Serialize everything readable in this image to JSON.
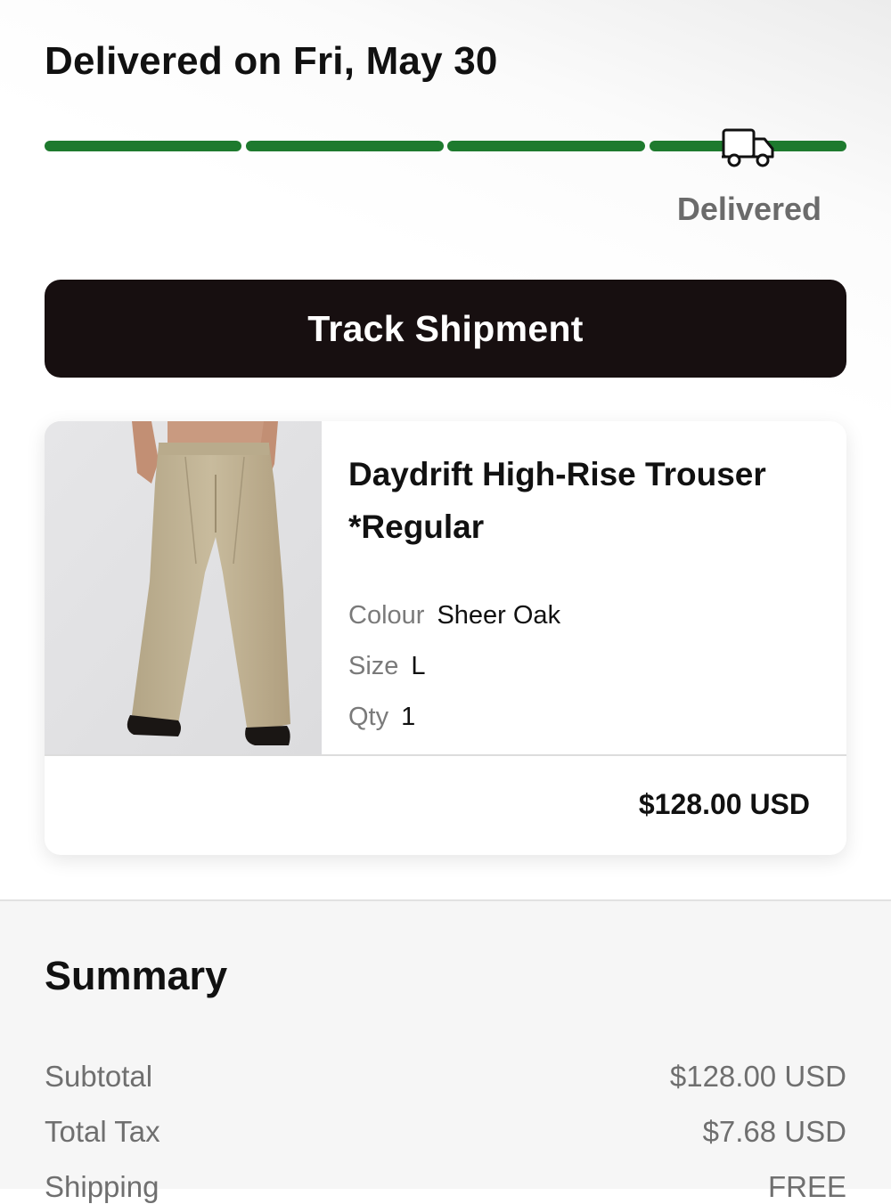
{
  "delivery": {
    "title": "Delivered on Fri, May 30",
    "status_label": "Delivered",
    "progress_fraction": 1.0,
    "progress_color": "#1e7a2e"
  },
  "actions": {
    "track_label": "Track Shipment"
  },
  "item": {
    "name": "Daydrift High-Rise Trouser *Regular",
    "colour_label": "Colour",
    "colour_value": "Sheer Oak",
    "size_label": "Size",
    "size_value": "L",
    "qty_label": "Qty",
    "qty_value": "1",
    "price": "$128.00 USD"
  },
  "summary": {
    "title": "Summary",
    "rows": [
      {
        "label": "Subtotal",
        "value": "$128.00 USD"
      },
      {
        "label": "Total Tax",
        "value": "$7.68 USD"
      },
      {
        "label": "Shipping",
        "value": "FREE"
      }
    ]
  },
  "icons": {
    "truck": "truck-icon"
  }
}
